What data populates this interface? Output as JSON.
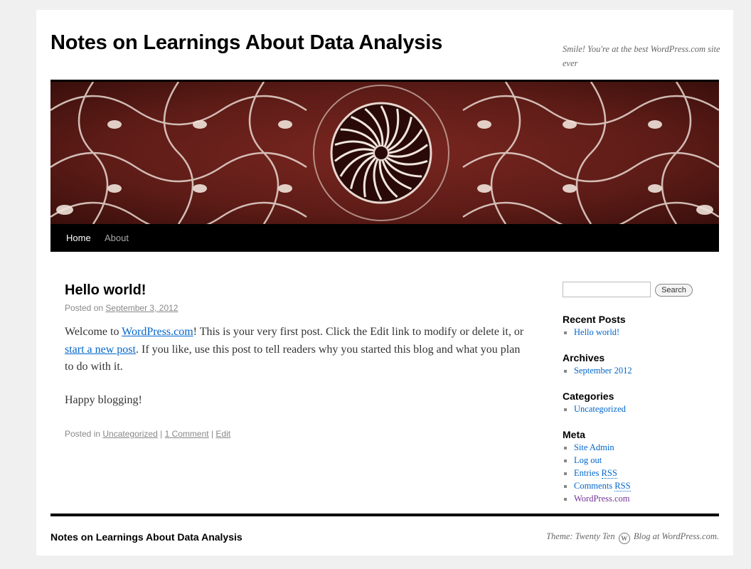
{
  "header": {
    "site_title": "Notes on Learnings About Data Analysis",
    "site_description": "Smile! You're at the best WordPress.com site ever"
  },
  "nav": {
    "items": [
      {
        "label": "Home"
      },
      {
        "label": "About"
      }
    ]
  },
  "post": {
    "title": "Hello world!",
    "posted_on_label": "Posted on",
    "date": "September 3, 2012",
    "p1_part1": "Welcome to ",
    "p1_link1": "WordPress.com",
    "p1_part2": "! This is your very first post. Click the Edit link to modify or delete it, or ",
    "p1_link2": "start a new post",
    "p1_part3": ". If you like, use this post to tell readers why you started this blog and what you plan to do with it.",
    "p2": "Happy blogging!",
    "posted_in_label": "Posted in",
    "category": "Uncategorized",
    "sep1": " | ",
    "comments": "1 Comment",
    "sep2": " | ",
    "edit": "Edit"
  },
  "sidebar": {
    "search_button": "Search",
    "recent_posts": {
      "title": "Recent Posts",
      "items": [
        "Hello world!"
      ]
    },
    "archives": {
      "title": "Archives",
      "items": [
        "September 2012"
      ]
    },
    "categories": {
      "title": "Categories",
      "items": [
        "Uncategorized"
      ]
    },
    "meta": {
      "title": "Meta",
      "site_admin": "Site Admin",
      "log_out": "Log out",
      "entries_prefix": "Entries ",
      "comments_prefix": "Comments ",
      "rss": "RSS",
      "wordpress": "WordPress.com"
    }
  },
  "footer": {
    "site_title": "Notes on Learnings About Data Analysis",
    "theme_text": "Theme: Twenty Ten",
    "logo_letter": "W",
    "blog_at": "Blog at WordPress.com."
  },
  "colors": {
    "link": "#0066cc",
    "visited_link": "#743399",
    "banner_base": "#5a1a16"
  }
}
